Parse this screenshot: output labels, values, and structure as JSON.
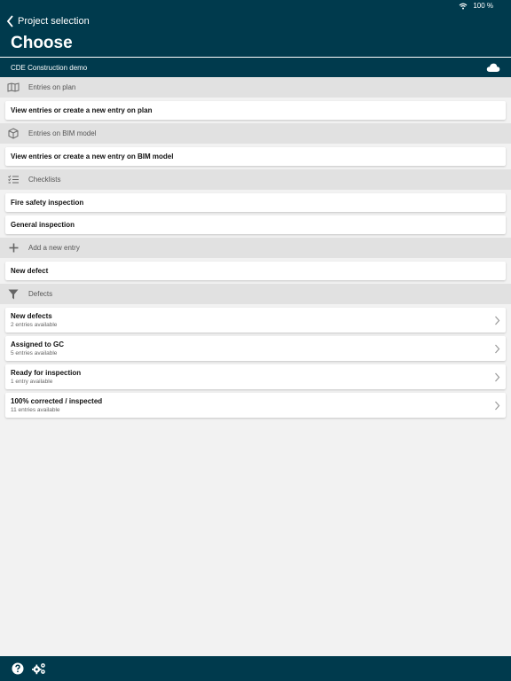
{
  "status": {
    "battery": "100 %"
  },
  "header": {
    "back_label": "Project selection",
    "title": "Choose",
    "project_name": "CDE Construction demo"
  },
  "sections": {
    "plan": {
      "label": "Entries on plan",
      "item": "View entries or create a new entry on plan"
    },
    "bim": {
      "label": "Entries on BIM model",
      "item": "View entries or create a new entry on BIM model"
    },
    "checklists": {
      "label": "Checklists",
      "items": [
        "Fire safety inspection",
        "General inspection"
      ]
    },
    "add": {
      "label": "Add a new entry",
      "item": "New defect"
    },
    "defects": {
      "label": "Defects",
      "items": [
        {
          "title": "New defects",
          "sub": "2 entries available"
        },
        {
          "title": "Assigned to GC",
          "sub": "5 entries available"
        },
        {
          "title": "Ready for inspection",
          "sub": "1 entry available"
        },
        {
          "title": "100% corrected / inspected",
          "sub": "11 entries available"
        }
      ]
    }
  },
  "icons": {
    "plan": "map-icon",
    "bim": "cube-icon",
    "checklists": "checklist-icon",
    "add": "plus-icon",
    "defects": "filter-icon",
    "help": "help-icon",
    "settings": "gears-icon"
  },
  "colors": {
    "header_bg": "#003a4d",
    "section_bg": "#e1e1e1",
    "page_bg": "#f2f2f2"
  }
}
